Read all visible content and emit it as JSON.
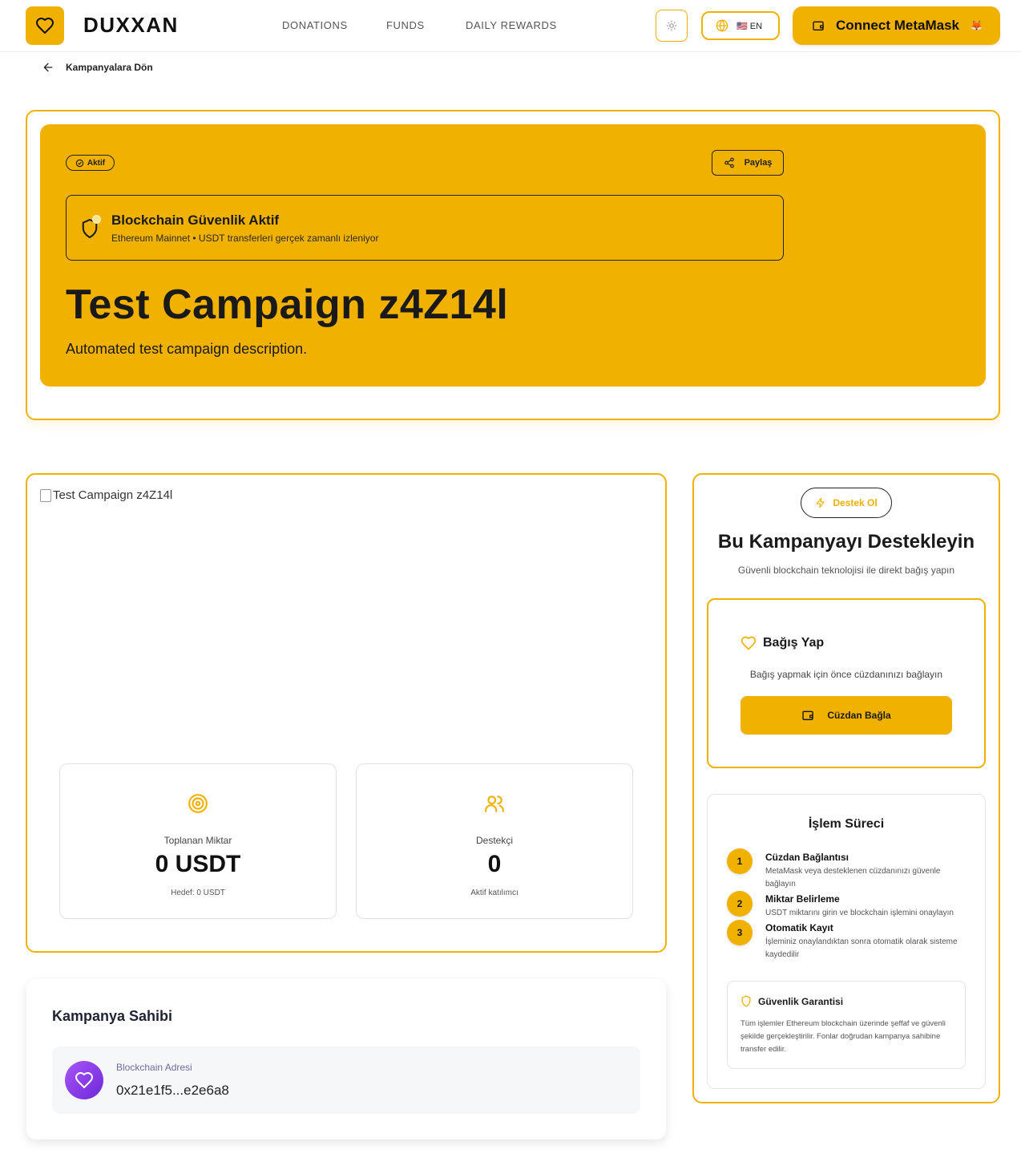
{
  "header": {
    "logo_text": "DUXXAN",
    "nav": [
      "DONATIONS",
      "FUNDS",
      "DAILY REWARDS"
    ],
    "lang_label": "🇺🇸 EN",
    "connect_label": "Connect MetaMask",
    "connect_icon": "🦊"
  },
  "back": {
    "label": "Kampanyalara Dön"
  },
  "hero": {
    "status_badge": "Aktif",
    "share_label": "Paylaş",
    "security_title": "Blockchain Güvenlik Aktif",
    "security_subtitle": "Ethereum Mainnet • USDT transferleri gerçek zamanlı izleniyor",
    "title": "Test Campaign z4Z14l",
    "description": "Automated test campaign description."
  },
  "campaign": {
    "image_alt": "Test Campaign z4Z14l",
    "stats": [
      {
        "label": "Toplanan Miktar",
        "value": "0 USDT",
        "note": "Hedef: 0 USDT",
        "icon": "target-icon"
      },
      {
        "label": "Destekçi",
        "value": "0",
        "note": "Aktif katılımcı",
        "icon": "users-icon"
      }
    ]
  },
  "owner": {
    "title": "Kampanya Sahibi",
    "address_label": "Blockchain Adresi",
    "address": "0x21e1f5...e2e6a8"
  },
  "support": {
    "pill": "Destek Ol",
    "title": "Bu Kampanyayı Destekleyin",
    "subtitle": "Güvenli blockchain teknolojisi ile direkt bağış yapın",
    "donate_title": "Bağış Yap",
    "donate_hint": "Bağış yapmak için önce cüzdanınızı bağlayın",
    "wallet_button": "Cüzdan Bağla"
  },
  "process": {
    "title": "İşlem Süreci",
    "steps": [
      {
        "num": "1",
        "title": "Cüzdan Bağlantısı",
        "desc": "MetaMask veya desteklenen cüzdanınızı güvenle bağlayın"
      },
      {
        "num": "2",
        "title": "Miktar Belirleme",
        "desc": "USDT miktarını girin ve blockchain işlemini onaylayın"
      },
      {
        "num": "3",
        "title": "Otomatik Kayıt",
        "desc": "İşleminiz onaylandıktan sonra otomatik olarak sisteme kaydedilir"
      }
    ],
    "guarantee_title": "Güvenlik Garantisi",
    "guarantee_text": "Tüm işlemler Ethereum blockchain üzerinde şeffaf ve güvenli şekilde gerçekleştirilir. Fonlar doğrudan kampanya sahibine transfer edilir."
  },
  "colors": {
    "accent": "#f0b100",
    "text": "#111111",
    "avatar_from": "#a855f7",
    "avatar_to": "#6d28d9"
  }
}
